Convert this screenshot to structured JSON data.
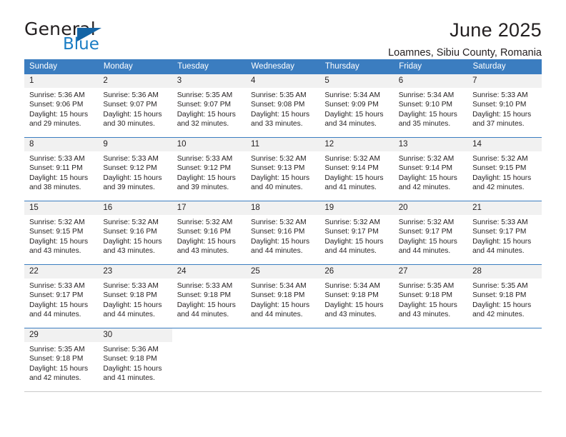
{
  "brand": {
    "name_part1": "General",
    "name_part2": "Blue",
    "triangle_icon": "blue-triangle-logo-mark"
  },
  "header": {
    "title": "June 2025",
    "subtitle": "Loamnes, Sibiu County, Romania"
  },
  "calendar": {
    "accent_color": "#3b7dc0",
    "daynum_background": "#f1f1f1",
    "weekday_headers": [
      "Sunday",
      "Monday",
      "Tuesday",
      "Wednesday",
      "Thursday",
      "Friday",
      "Saturday"
    ],
    "labels": {
      "sunrise_prefix": "Sunrise:",
      "sunset_prefix": "Sunset:",
      "daylight_prefix": "Daylight:"
    },
    "weeks": [
      [
        {
          "day": "1",
          "sunrise": "Sunrise: 5:36 AM",
          "sunset": "Sunset: 9:06 PM",
          "daylight_line1": "Daylight: 15 hours",
          "daylight_line2": "and 29 minutes."
        },
        {
          "day": "2",
          "sunrise": "Sunrise: 5:36 AM",
          "sunset": "Sunset: 9:07 PM",
          "daylight_line1": "Daylight: 15 hours",
          "daylight_line2": "and 30 minutes."
        },
        {
          "day": "3",
          "sunrise": "Sunrise: 5:35 AM",
          "sunset": "Sunset: 9:07 PM",
          "daylight_line1": "Daylight: 15 hours",
          "daylight_line2": "and 32 minutes."
        },
        {
          "day": "4",
          "sunrise": "Sunrise: 5:35 AM",
          "sunset": "Sunset: 9:08 PM",
          "daylight_line1": "Daylight: 15 hours",
          "daylight_line2": "and 33 minutes."
        },
        {
          "day": "5",
          "sunrise": "Sunrise: 5:34 AM",
          "sunset": "Sunset: 9:09 PM",
          "daylight_line1": "Daylight: 15 hours",
          "daylight_line2": "and 34 minutes."
        },
        {
          "day": "6",
          "sunrise": "Sunrise: 5:34 AM",
          "sunset": "Sunset: 9:10 PM",
          "daylight_line1": "Daylight: 15 hours",
          "daylight_line2": "and 35 minutes."
        },
        {
          "day": "7",
          "sunrise": "Sunrise: 5:33 AM",
          "sunset": "Sunset: 9:10 PM",
          "daylight_line1": "Daylight: 15 hours",
          "daylight_line2": "and 37 minutes."
        }
      ],
      [
        {
          "day": "8",
          "sunrise": "Sunrise: 5:33 AM",
          "sunset": "Sunset: 9:11 PM",
          "daylight_line1": "Daylight: 15 hours",
          "daylight_line2": "and 38 minutes."
        },
        {
          "day": "9",
          "sunrise": "Sunrise: 5:33 AM",
          "sunset": "Sunset: 9:12 PM",
          "daylight_line1": "Daylight: 15 hours",
          "daylight_line2": "and 39 minutes."
        },
        {
          "day": "10",
          "sunrise": "Sunrise: 5:33 AM",
          "sunset": "Sunset: 9:12 PM",
          "daylight_line1": "Daylight: 15 hours",
          "daylight_line2": "and 39 minutes."
        },
        {
          "day": "11",
          "sunrise": "Sunrise: 5:32 AM",
          "sunset": "Sunset: 9:13 PM",
          "daylight_line1": "Daylight: 15 hours",
          "daylight_line2": "and 40 minutes."
        },
        {
          "day": "12",
          "sunrise": "Sunrise: 5:32 AM",
          "sunset": "Sunset: 9:14 PM",
          "daylight_line1": "Daylight: 15 hours",
          "daylight_line2": "and 41 minutes."
        },
        {
          "day": "13",
          "sunrise": "Sunrise: 5:32 AM",
          "sunset": "Sunset: 9:14 PM",
          "daylight_line1": "Daylight: 15 hours",
          "daylight_line2": "and 42 minutes."
        },
        {
          "day": "14",
          "sunrise": "Sunrise: 5:32 AM",
          "sunset": "Sunset: 9:15 PM",
          "daylight_line1": "Daylight: 15 hours",
          "daylight_line2": "and 42 minutes."
        }
      ],
      [
        {
          "day": "15",
          "sunrise": "Sunrise: 5:32 AM",
          "sunset": "Sunset: 9:15 PM",
          "daylight_line1": "Daylight: 15 hours",
          "daylight_line2": "and 43 minutes."
        },
        {
          "day": "16",
          "sunrise": "Sunrise: 5:32 AM",
          "sunset": "Sunset: 9:16 PM",
          "daylight_line1": "Daylight: 15 hours",
          "daylight_line2": "and 43 minutes."
        },
        {
          "day": "17",
          "sunrise": "Sunrise: 5:32 AM",
          "sunset": "Sunset: 9:16 PM",
          "daylight_line1": "Daylight: 15 hours",
          "daylight_line2": "and 43 minutes."
        },
        {
          "day": "18",
          "sunrise": "Sunrise: 5:32 AM",
          "sunset": "Sunset: 9:16 PM",
          "daylight_line1": "Daylight: 15 hours",
          "daylight_line2": "and 44 minutes."
        },
        {
          "day": "19",
          "sunrise": "Sunrise: 5:32 AM",
          "sunset": "Sunset: 9:17 PM",
          "daylight_line1": "Daylight: 15 hours",
          "daylight_line2": "and 44 minutes."
        },
        {
          "day": "20",
          "sunrise": "Sunrise: 5:32 AM",
          "sunset": "Sunset: 9:17 PM",
          "daylight_line1": "Daylight: 15 hours",
          "daylight_line2": "and 44 minutes."
        },
        {
          "day": "21",
          "sunrise": "Sunrise: 5:33 AM",
          "sunset": "Sunset: 9:17 PM",
          "daylight_line1": "Daylight: 15 hours",
          "daylight_line2": "and 44 minutes."
        }
      ],
      [
        {
          "day": "22",
          "sunrise": "Sunrise: 5:33 AM",
          "sunset": "Sunset: 9:17 PM",
          "daylight_line1": "Daylight: 15 hours",
          "daylight_line2": "and 44 minutes."
        },
        {
          "day": "23",
          "sunrise": "Sunrise: 5:33 AM",
          "sunset": "Sunset: 9:18 PM",
          "daylight_line1": "Daylight: 15 hours",
          "daylight_line2": "and 44 minutes."
        },
        {
          "day": "24",
          "sunrise": "Sunrise: 5:33 AM",
          "sunset": "Sunset: 9:18 PM",
          "daylight_line1": "Daylight: 15 hours",
          "daylight_line2": "and 44 minutes."
        },
        {
          "day": "25",
          "sunrise": "Sunrise: 5:34 AM",
          "sunset": "Sunset: 9:18 PM",
          "daylight_line1": "Daylight: 15 hours",
          "daylight_line2": "and 44 minutes."
        },
        {
          "day": "26",
          "sunrise": "Sunrise: 5:34 AM",
          "sunset": "Sunset: 9:18 PM",
          "daylight_line1": "Daylight: 15 hours",
          "daylight_line2": "and 43 minutes."
        },
        {
          "day": "27",
          "sunrise": "Sunrise: 5:35 AM",
          "sunset": "Sunset: 9:18 PM",
          "daylight_line1": "Daylight: 15 hours",
          "daylight_line2": "and 43 minutes."
        },
        {
          "day": "28",
          "sunrise": "Sunrise: 5:35 AM",
          "sunset": "Sunset: 9:18 PM",
          "daylight_line1": "Daylight: 15 hours",
          "daylight_line2": "and 42 minutes."
        }
      ],
      [
        {
          "day": "29",
          "sunrise": "Sunrise: 5:35 AM",
          "sunset": "Sunset: 9:18 PM",
          "daylight_line1": "Daylight: 15 hours",
          "daylight_line2": "and 42 minutes."
        },
        {
          "day": "30",
          "sunrise": "Sunrise: 5:36 AM",
          "sunset": "Sunset: 9:18 PM",
          "daylight_line1": "Daylight: 15 hours",
          "daylight_line2": "and 41 minutes."
        },
        {
          "day": "",
          "sunrise": "",
          "sunset": "",
          "daylight_line1": "",
          "daylight_line2": ""
        },
        {
          "day": "",
          "sunrise": "",
          "sunset": "",
          "daylight_line1": "",
          "daylight_line2": ""
        },
        {
          "day": "",
          "sunrise": "",
          "sunset": "",
          "daylight_line1": "",
          "daylight_line2": ""
        },
        {
          "day": "",
          "sunrise": "",
          "sunset": "",
          "daylight_line1": "",
          "daylight_line2": ""
        },
        {
          "day": "",
          "sunrise": "",
          "sunset": "",
          "daylight_line1": "",
          "daylight_line2": ""
        }
      ]
    ]
  }
}
